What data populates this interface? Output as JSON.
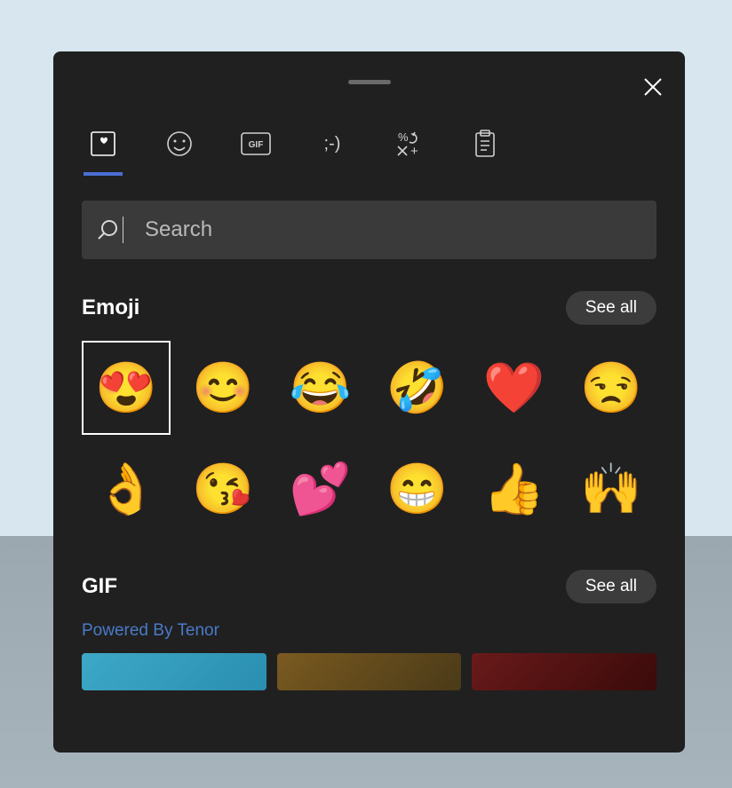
{
  "panel": {
    "tabs": [
      {
        "name": "recents",
        "active": true
      },
      {
        "name": "emoji",
        "active": false
      },
      {
        "name": "gif",
        "active": false
      },
      {
        "name": "kaomoji",
        "active": false
      },
      {
        "name": "symbols",
        "active": false
      },
      {
        "name": "clipboard",
        "active": false
      }
    ],
    "search": {
      "placeholder": "Search",
      "value": ""
    },
    "sections": {
      "emoji": {
        "title": "Emoji",
        "see_all": "See all",
        "items": [
          {
            "name": "smiling-face-with-heart-eyes",
            "glyph": "😍",
            "selected": true
          },
          {
            "name": "smiling-face-with-smiling-eyes",
            "glyph": "😊",
            "selected": false
          },
          {
            "name": "face-with-tears-of-joy",
            "glyph": "😂",
            "selected": false
          },
          {
            "name": "rolling-on-the-floor-laughing",
            "glyph": "🤣",
            "selected": false
          },
          {
            "name": "red-heart",
            "glyph": "❤️",
            "selected": false
          },
          {
            "name": "unamused-face",
            "glyph": "😒",
            "selected": false
          },
          {
            "name": "ok-hand",
            "glyph": "👌",
            "selected": false
          },
          {
            "name": "face-blowing-a-kiss",
            "glyph": "😘",
            "selected": false
          },
          {
            "name": "two-hearts",
            "glyph": "💕",
            "selected": false
          },
          {
            "name": "beaming-face-with-smiling-eyes",
            "glyph": "😁",
            "selected": false
          },
          {
            "name": "thumbs-up",
            "glyph": "👍",
            "selected": false
          },
          {
            "name": "raising-hands",
            "glyph": "🙌",
            "selected": false
          }
        ]
      },
      "gif": {
        "title": "GIF",
        "see_all": "See all",
        "provider": "Powered By Tenor",
        "thumbs": [
          {
            "name": "gif-thumb-1"
          },
          {
            "name": "gif-thumb-2"
          },
          {
            "name": "gif-thumb-3"
          }
        ]
      }
    }
  }
}
